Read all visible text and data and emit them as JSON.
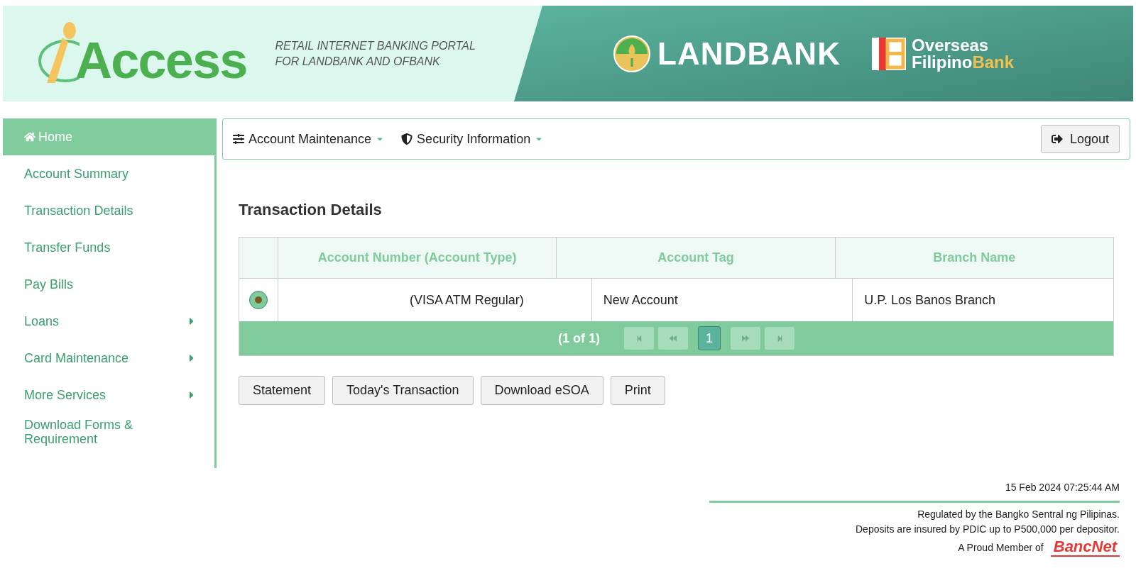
{
  "header": {
    "logo": "Access",
    "tagline": [
      "RETAIL INTERNET BANKING PORTAL",
      "FOR LANDBANK AND OFBANK"
    ],
    "bank": "LANDBANK",
    "partner": {
      "line1": "Overseas",
      "line2a": "Filipino",
      "line2b": "Bank"
    }
  },
  "sidebar": {
    "items": [
      {
        "label": "Home",
        "selected": true,
        "submenu": false
      },
      {
        "label": "Account Summary",
        "selected": false,
        "submenu": false
      },
      {
        "label": "Transaction Details",
        "selected": false,
        "submenu": false
      },
      {
        "label": "Transfer Funds",
        "selected": false,
        "submenu": false
      },
      {
        "label": "Pay Bills",
        "selected": false,
        "submenu": false
      },
      {
        "label": "Loans",
        "selected": false,
        "submenu": true
      },
      {
        "label": "Card Maintenance",
        "selected": false,
        "submenu": true
      },
      {
        "label": "More Services",
        "selected": false,
        "submenu": true
      },
      {
        "label": "Download Forms & Requirement",
        "selected": false,
        "submenu": false
      }
    ]
  },
  "toolbar": {
    "menus": [
      {
        "label": "Account Maintenance"
      },
      {
        "label": "Security Information"
      }
    ],
    "logout": "Logout"
  },
  "page_title": "Transaction Details",
  "table": {
    "columns": [
      "Account Number (Account Type)",
      "Account Tag",
      "Branch Name"
    ],
    "rows": [
      {
        "selected": true,
        "cells": [
          "(VISA ATM Regular)",
          "New Account",
          "U.P. Los Banos Branch"
        ]
      }
    ],
    "pager": {
      "summary": "(1 of 1)",
      "pages": [
        {
          "label": "1",
          "selected": true
        }
      ]
    }
  },
  "actions": [
    "Statement",
    "Today's Transaction",
    "Download eSOA",
    "Print"
  ],
  "footer": {
    "timestamp": "15 Feb 2024 07:25:44 AM",
    "notes": [
      "Regulated by the Bangko Sentral ng Pilipinas.",
      "Deposits are insured by PDIC up to P500,000 per depositor."
    ],
    "member": "A Proud Member of",
    "member_logo": "BancNet"
  }
}
